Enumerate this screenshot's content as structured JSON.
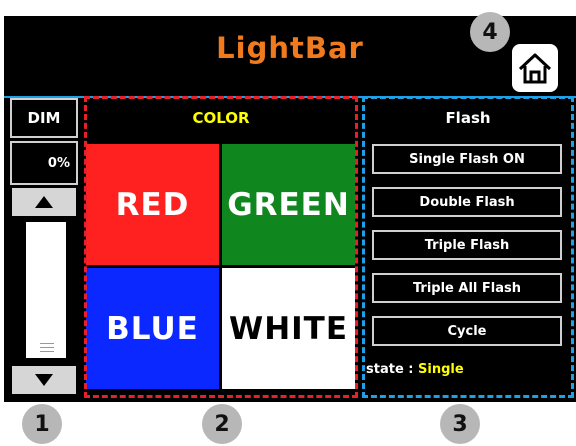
{
  "header": {
    "title": "LightBar",
    "home_icon": "home-icon"
  },
  "dim": {
    "label": "DIM",
    "value_text": "0%",
    "level_percent": 0,
    "up_icon": "triangle-up-icon",
    "down_icon": "triangle-down-icon"
  },
  "color": {
    "label": "COLOR",
    "swatches": [
      {
        "label": "RED",
        "color": "#ff2020"
      },
      {
        "label": "GREEN",
        "color": "#10861e"
      },
      {
        "label": "BLUE",
        "color": "#0a28ff"
      },
      {
        "label": "WHITE",
        "color": "#ffffff"
      }
    ]
  },
  "flash": {
    "label": "Flash",
    "buttons": [
      "Single Flash ON",
      "Double Flash",
      "Triple Flash",
      "Triple All Flash",
      "Cycle"
    ],
    "state_label": "state : ",
    "state_value": "Single"
  },
  "markers": [
    "1",
    "2",
    "3",
    "4"
  ],
  "colors": {
    "title": "#f07a1e",
    "accent": "#ffff00",
    "frame_red": "#e8202a",
    "frame_blue": "#1ea0e6"
  }
}
